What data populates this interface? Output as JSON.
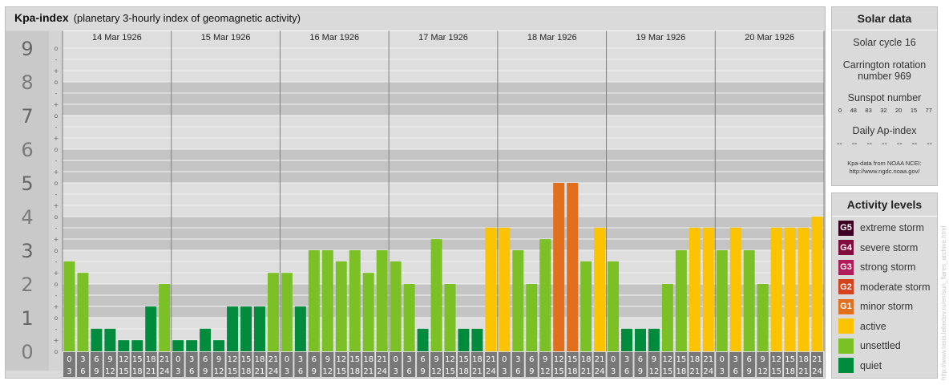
{
  "header": {
    "title": "Kpa-index",
    "subtitle": "(planetary 3-hourly index of geomagnetic activity)"
  },
  "chart_data": {
    "type": "bar",
    "y_ticks": [
      "0",
      "1",
      "2",
      "3",
      "4",
      "5",
      "6",
      "7",
      "8",
      "9"
    ],
    "sub_ticks": [
      "-",
      "o",
      "+"
    ],
    "ylim": [
      0,
      9.33
    ],
    "days": [
      "14 Mar 1926",
      "15 Mar 1926",
      "16 Mar 1926",
      "17 Mar 1926",
      "18 Mar 1926",
      "19 Mar 1926",
      "20 Mar 1926"
    ],
    "interval_labels": [
      [
        "0",
        "3"
      ],
      [
        "3",
        "6"
      ],
      [
        "6",
        "9"
      ],
      [
        "9",
        "12"
      ],
      [
        "12",
        "15"
      ],
      [
        "15",
        "18"
      ],
      [
        "18",
        "21"
      ],
      [
        "21",
        "24"
      ]
    ],
    "values": [
      2.67,
      2.33,
      0.67,
      0.67,
      0.33,
      0.33,
      1.33,
      2.0,
      0.33,
      0.33,
      0.67,
      0.33,
      1.33,
      1.33,
      1.33,
      2.33,
      2.33,
      1.33,
      3.0,
      3.0,
      2.67,
      3.0,
      2.33,
      3.0,
      2.67,
      2.0,
      0.67,
      3.33,
      2.0,
      0.67,
      0.67,
      3.67,
      3.67,
      3.0,
      2.0,
      3.33,
      5.0,
      5.0,
      2.67,
      3.67,
      2.67,
      0.67,
      0.67,
      0.67,
      2.0,
      3.0,
      3.67,
      3.67,
      3.0,
      3.67,
      3.0,
      2.0,
      3.67,
      3.67,
      3.67,
      4.0
    ],
    "level_colors": {
      "quiet": "#008b3d",
      "unsettled": "#7bc126",
      "active": "#fcc300",
      "g1": "#e16f1b",
      "g2": "#d4431d",
      "g3": "#b01c5a",
      "g4": "#820d3d",
      "g5": "#3c0022"
    }
  },
  "solar": {
    "header": "Solar data",
    "cycle": "Solar cycle 16",
    "carrington_line1": "Carrington rotation",
    "carrington_line2": "number 969",
    "sunspot_label": "Sunspot number",
    "sunspot_values": [
      "0",
      "48",
      "83",
      "32",
      "20",
      "15",
      "77"
    ],
    "ap_label": "Daily Ap-index",
    "ap_values": [
      "--",
      "--",
      "--",
      "--",
      "--",
      "--",
      "--"
    ],
    "credit_line1": "Kpa-data from NOAA NCEI:",
    "credit_line2": "http://www.ngdc.noaa.gov/"
  },
  "activity": {
    "header": "Activity levels",
    "levels": [
      {
        "code": "G5",
        "label": "extreme storm",
        "color": "#3c0022"
      },
      {
        "code": "G4",
        "label": "severe storm",
        "color": "#820d3d"
      },
      {
        "code": "G3",
        "label": "strong storm",
        "color": "#b01c5a"
      },
      {
        "code": "G2",
        "label": "moderate storm",
        "color": "#d4431d"
      },
      {
        "code": "G1",
        "label": "minor storm",
        "color": "#e16f1b"
      },
      {
        "code": "",
        "label": "active",
        "color": "#fcc300"
      },
      {
        "code": "",
        "label": "unsettled",
        "color": "#7bc126"
      },
      {
        "code": "",
        "label": "quiet",
        "color": "#008b3d"
      }
    ]
  },
  "watermark": "http://www.tesis.lebedev.ru/en/sun_flares_archive.html"
}
